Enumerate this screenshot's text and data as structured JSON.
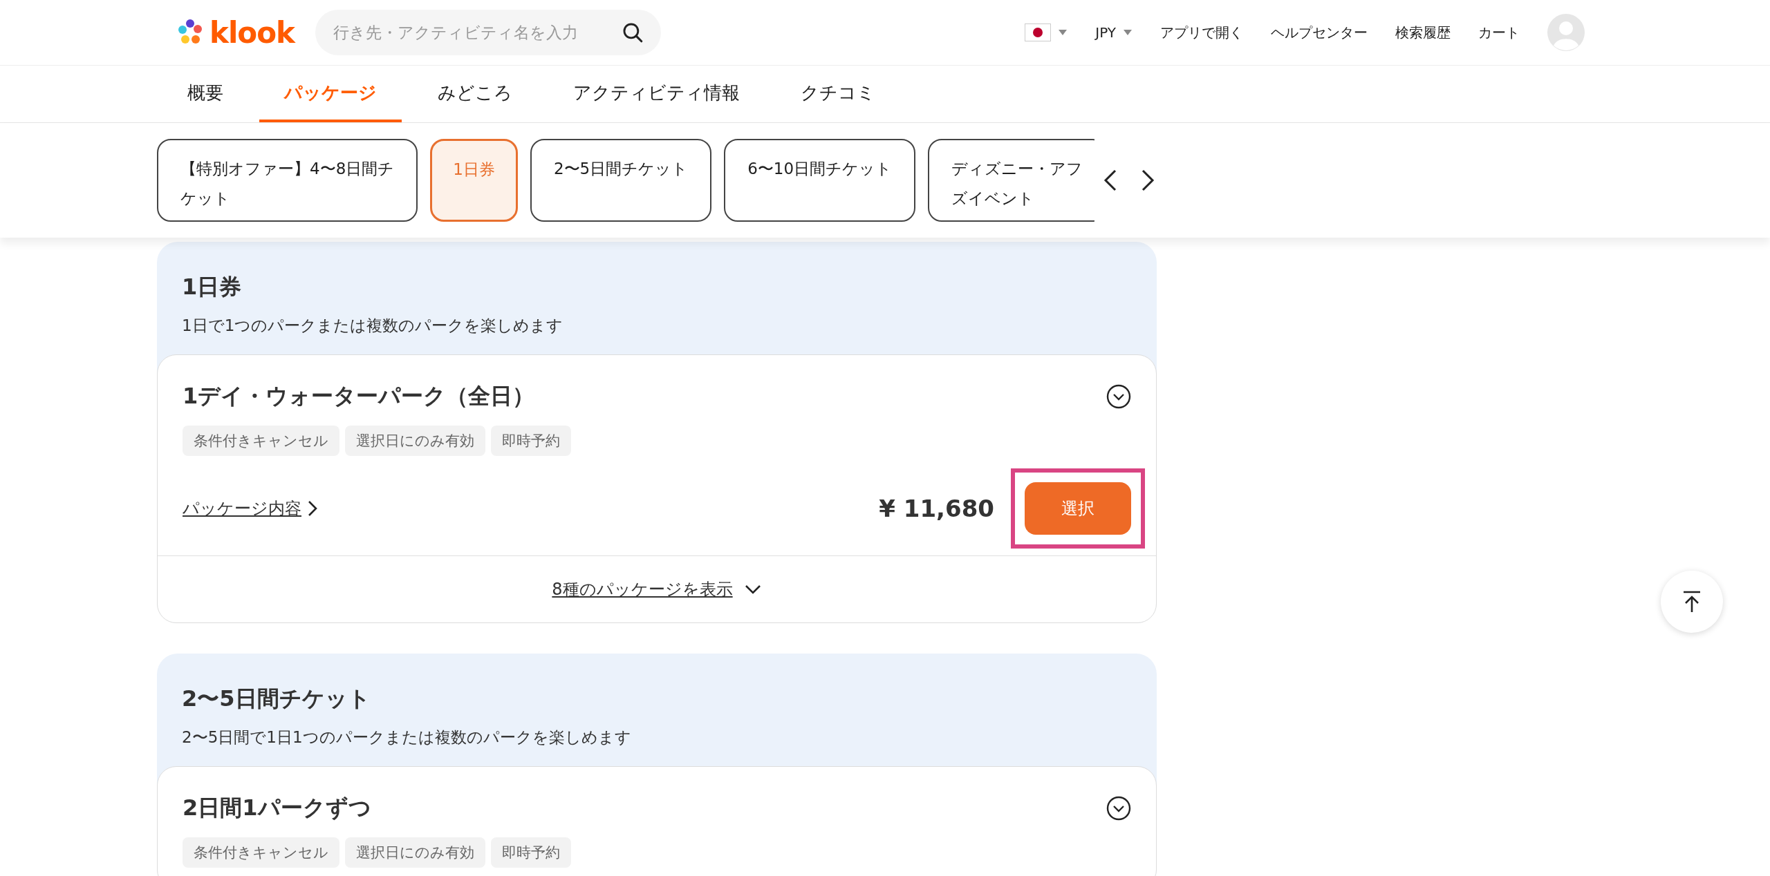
{
  "header": {
    "logo": "klook",
    "search": {
      "placeholder": "行き先・アクティビティ名を入力"
    },
    "currency": "JPY",
    "links": [
      "アプリで開く",
      "ヘルプセンター",
      "検索履歴",
      "カート"
    ]
  },
  "nav_tabs": [
    {
      "label": "概要",
      "selected": false
    },
    {
      "label": "パッケージ",
      "selected": true
    },
    {
      "label": "みどころ",
      "selected": false
    },
    {
      "label": "アクティビティ情報",
      "selected": false
    },
    {
      "label": "クチコミ",
      "selected": false
    }
  ],
  "package_chips": [
    {
      "lines": [
        "【特別オファー】4〜8日間チ",
        "ケット"
      ],
      "selected": false
    },
    {
      "lines": [
        "1日券"
      ],
      "selected": true
    },
    {
      "lines": [
        "2〜5日間チケット"
      ],
      "selected": false
    },
    {
      "lines": [
        "6〜10日間チケット"
      ],
      "selected": false
    },
    {
      "lines": [
        "ディズニー・アフ",
        "ズイベント"
      ],
      "selected": false
    }
  ],
  "sections": [
    {
      "title": "1日券",
      "description": "1日で1つのパークまたは複数のパークを楽しめます",
      "packages": [
        {
          "name": "1デイ・ウォーターパーク（全日）",
          "tags": [
            "条件付きキャンセル",
            "選択日にのみ有効",
            "即時予約"
          ],
          "details_link": "パッケージ内容",
          "price": "¥ 11,680",
          "button": "選択",
          "highlighted": true
        }
      ],
      "more_link": "8種のパッケージを表示"
    },
    {
      "title": "2〜5日間チケット",
      "description": "2〜5日間で1日1つのパークまたは複数のパークを楽しめます",
      "packages": [
        {
          "name": "2日間1パークずつ",
          "tags": [
            "条件付きキャンセル",
            "選択日にのみ有効",
            "即時予約"
          ]
        }
      ]
    }
  ]
}
